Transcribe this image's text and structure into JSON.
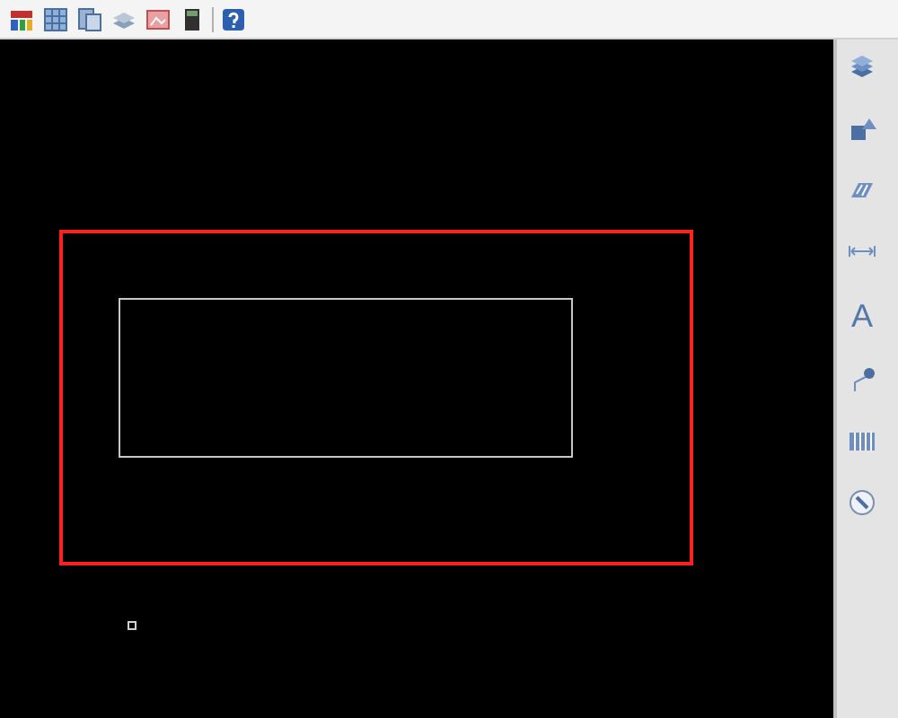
{
  "canvas": {
    "shapes": [
      {
        "kind": "rectangle",
        "color": "#ff2020"
      },
      {
        "kind": "rectangle",
        "color": "#c8c8c8"
      },
      {
        "kind": "marker",
        "color": "#d0d0d0"
      }
    ]
  },
  "tool_panel": {
    "text_tool": "A"
  }
}
